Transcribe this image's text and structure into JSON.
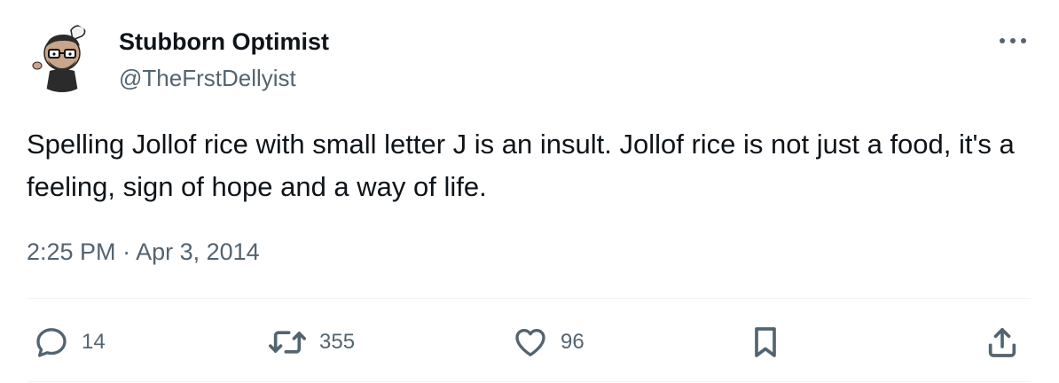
{
  "author": {
    "display_name": "Stubborn Optimist",
    "handle": "@TheFrstDellyist",
    "avatar_icon": "cartoon-chef-avatar"
  },
  "more_icon": "more-dots-icon",
  "tweet": {
    "text": "Spelling Jollof rice with small letter J is an insult. Jollof rice is not just a food, it's a feeling, sign of hope and a way of life.",
    "time": "2:25 PM",
    "separator": "·",
    "date": "Apr 3, 2014"
  },
  "actions": {
    "reply": {
      "icon": "reply-icon",
      "count": "14"
    },
    "retweet": {
      "icon": "retweet-icon",
      "count": "355"
    },
    "like": {
      "icon": "heart-icon",
      "count": "96"
    },
    "bookmark": {
      "icon": "bookmark-icon"
    },
    "share": {
      "icon": "share-icon"
    }
  },
  "colors": {
    "text": "#0f1419",
    "secondary": "#536471",
    "divider": "#eff3f4"
  }
}
